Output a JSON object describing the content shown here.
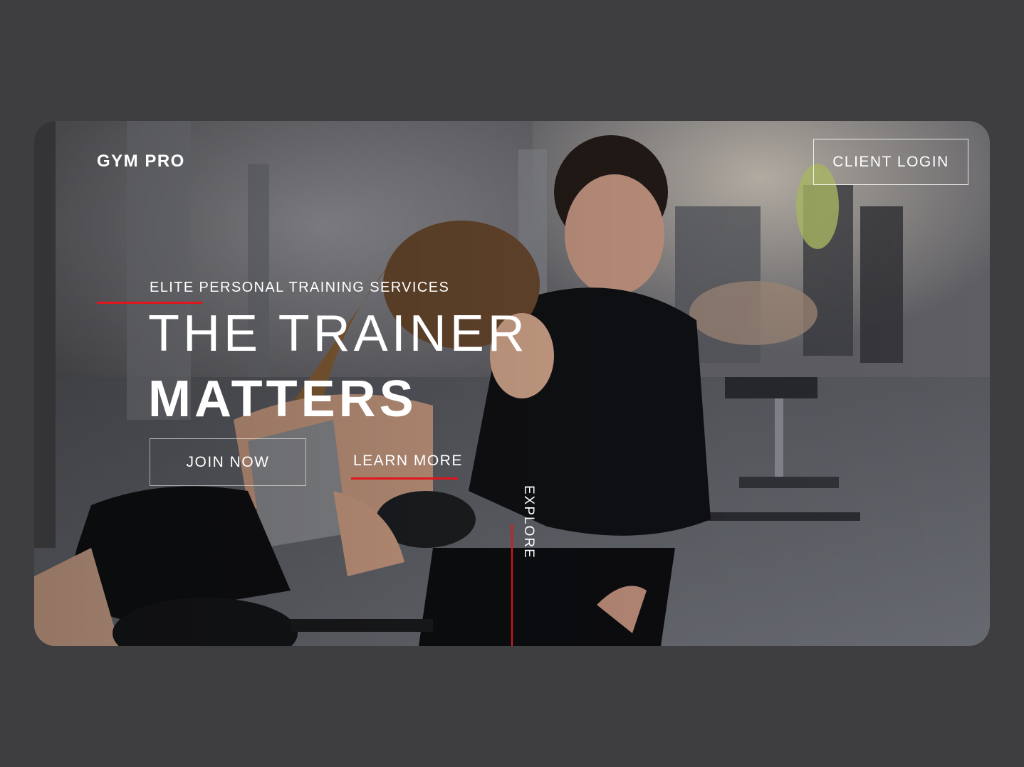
{
  "brand": {
    "logo_text": "GYM PRO"
  },
  "header": {
    "login_label": "CLIENT LOGIN"
  },
  "hero": {
    "eyebrow": "ELITE PERSONAL TRAINING SERVICES",
    "headline_line1": "THE TRAINER",
    "headline_line2": "MATTERS",
    "primary_cta": "JOIN NOW",
    "secondary_cta": "LEARN MORE",
    "explore_label": "EXPLORE"
  },
  "colors": {
    "page_background": "#3e3e40",
    "accent": "#e0161c",
    "text": "#ffffff"
  }
}
